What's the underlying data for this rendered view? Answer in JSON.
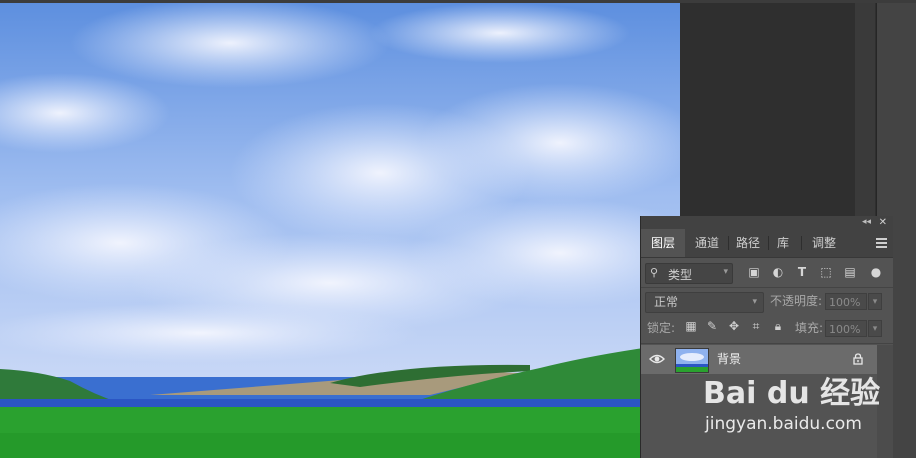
{
  "panel": {
    "collapse_glyph": "◂◂",
    "close_glyph": "✕",
    "tabs": [
      {
        "label": "图层",
        "active": true
      },
      {
        "label": "通道",
        "active": false
      },
      {
        "label": "路径",
        "active": false
      },
      {
        "label": "库",
        "active": false
      },
      {
        "label": "调整",
        "active": false
      }
    ],
    "filter": {
      "kind_label": "类型",
      "icons": [
        "image-filter-icon",
        "adjustment-filter-icon",
        "type-filter-icon",
        "shape-filter-icon",
        "smart-object-filter-icon",
        "filter-toggle-icon"
      ]
    },
    "blend_mode": "正常",
    "opacity": {
      "label": "不透明度:",
      "value": "100%"
    },
    "lock": {
      "label": "锁定:",
      "icons": [
        "lock-transparent-icon",
        "lock-image-icon",
        "lock-position-icon",
        "lock-artboard-icon",
        "lock-all-icon"
      ]
    },
    "fill": {
      "label": "填充:",
      "value": "100%"
    },
    "layers": [
      {
        "name": "背景",
        "visible": true,
        "locked": true
      }
    ]
  },
  "watermark": {
    "logo_text": "Bai du 经验",
    "url": "jingyan.baidu.com"
  },
  "colors": {
    "panel_bg": "#535353",
    "panel_header": "#424242",
    "selected_layer": "#6b6b6b",
    "workspace": "#2f2f2f"
  }
}
